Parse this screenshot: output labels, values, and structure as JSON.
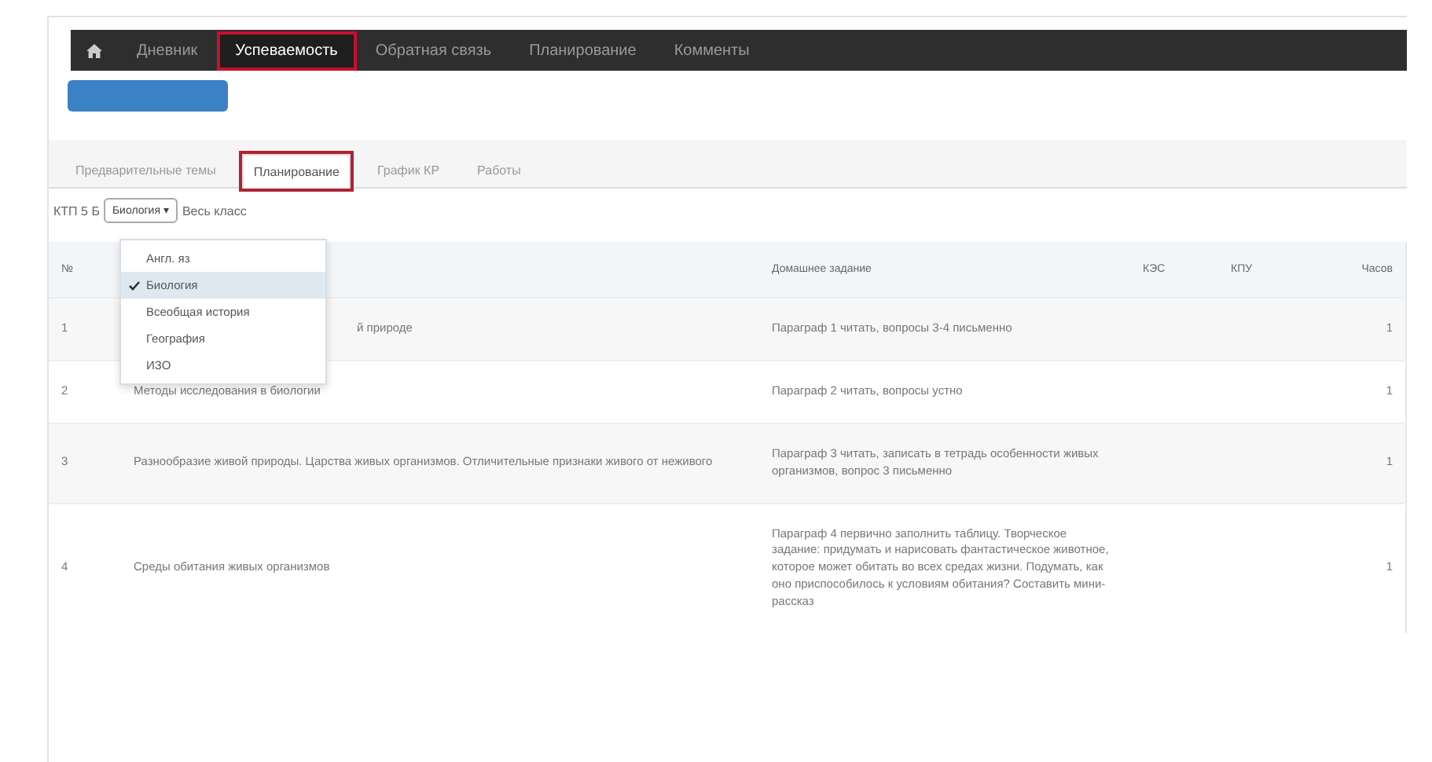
{
  "navbar": {
    "items": [
      {
        "label": "Дневник",
        "selected": false,
        "highlighted": false
      },
      {
        "label": "Успеваемость",
        "selected": true,
        "highlighted": true
      },
      {
        "label": "Обратная связь",
        "selected": false,
        "highlighted": false
      },
      {
        "label": "Планирование",
        "selected": false,
        "highlighted": false
      },
      {
        "label": "Комменты",
        "selected": false,
        "highlighted": false
      }
    ]
  },
  "tabs": [
    {
      "label": "Предварительные темы",
      "selected": false,
      "highlighted": false
    },
    {
      "label": "Планирование",
      "selected": true,
      "highlighted": true
    },
    {
      "label": "График КР",
      "selected": false,
      "highlighted": false
    },
    {
      "label": "Работы",
      "selected": false,
      "highlighted": false
    }
  ],
  "filter": {
    "label": "КТП 5 Б",
    "subject": "Биология",
    "caret": "▾",
    "group": "Весь класс"
  },
  "dropdown": {
    "options": [
      {
        "label": "Англ. яз",
        "selected": false
      },
      {
        "label": "Биология",
        "selected": true
      },
      {
        "label": "Всеобщая история",
        "selected": false
      },
      {
        "label": "География",
        "selected": false
      },
      {
        "label": "ИЗО",
        "selected": false
      }
    ]
  },
  "table": {
    "columns": [
      "№",
      "",
      "Домашнее задание",
      "КЭС",
      "КПУ",
      "Часов"
    ],
    "rows": [
      {
        "number": "1",
        "topic": "й природе",
        "homework": "Параграф 1 читать, вопросы 3-4 письменно",
        "hours": "1"
      },
      {
        "number": "2",
        "topic": "Методы исследования в биологии",
        "homework": "Параграф 2 читать, вопросы устно",
        "hours": "1"
      },
      {
        "number": "3",
        "topic": "Разнообразие живой природы. Царства живых организмов. Отличительные признаки живого от неживого",
        "homework": "Параграф 3 читать, записать в тетрадь особенности живых организмов, вопрос 3 письменно",
        "hours": "1"
      },
      {
        "number": "4",
        "topic": "Среды обитания живых организмов",
        "homework": "Параграф 4 первично заполнить таблицу. Творческое задание: придумать и нарисовать фантастическое животное, которое может обитать во всех средах жизни. Подумать, как оно приспособилось к условиям обитания? Составить мини-рассказ",
        "hours": "1"
      }
    ]
  }
}
